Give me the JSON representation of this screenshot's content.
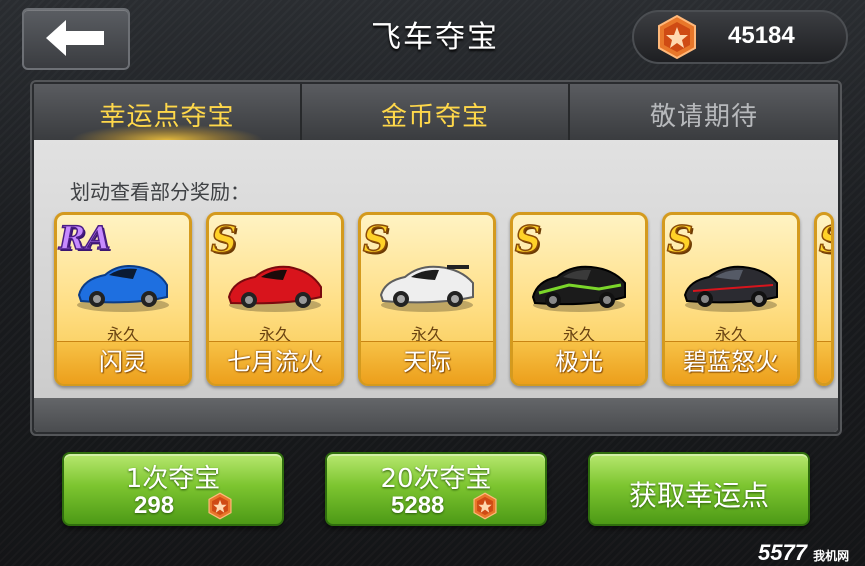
{
  "header": {
    "title": "飞车夺宝",
    "coins": "45184"
  },
  "tabs": [
    {
      "label": "幸运点夺宝",
      "state": "active"
    },
    {
      "label": "金币夺宝",
      "state": "normal"
    },
    {
      "label": "敬请期待",
      "state": "disabled"
    }
  ],
  "rewards": {
    "hint": "划动查看部分奖励：",
    "items": [
      {
        "grade": "RA",
        "duration": "永久",
        "name": "闪灵",
        "car_color": "#1e6fe0"
      },
      {
        "grade": "S",
        "duration": "永久",
        "name": "七月流火",
        "car_color": "#d8141c"
      },
      {
        "grade": "S",
        "duration": "永久",
        "name": "天际",
        "car_color": "#eeeeee"
      },
      {
        "grade": "S",
        "duration": "永久",
        "name": "极光",
        "car_color": "#1b1b1b"
      },
      {
        "grade": "S",
        "duration": "永久",
        "name": "碧蓝怒火",
        "car_color": "#2b2b31"
      },
      {
        "grade": "S",
        "duration": "",
        "name": "",
        "car_color": "#333333"
      }
    ]
  },
  "actions": {
    "draw_once": {
      "label": "1次夺宝",
      "price": "298"
    },
    "draw_twenty": {
      "label": "20次夺宝",
      "price": "5288"
    },
    "get_lucky": {
      "label": "获取幸运点"
    }
  },
  "watermark": {
    "logo": "5577",
    "logo_sub": "我机网"
  },
  "colors": {
    "accent_gold": "#ffd84a",
    "card_bg": "#ffde84",
    "button_green": "#7dc530",
    "medal_orange": "#e8772a"
  }
}
